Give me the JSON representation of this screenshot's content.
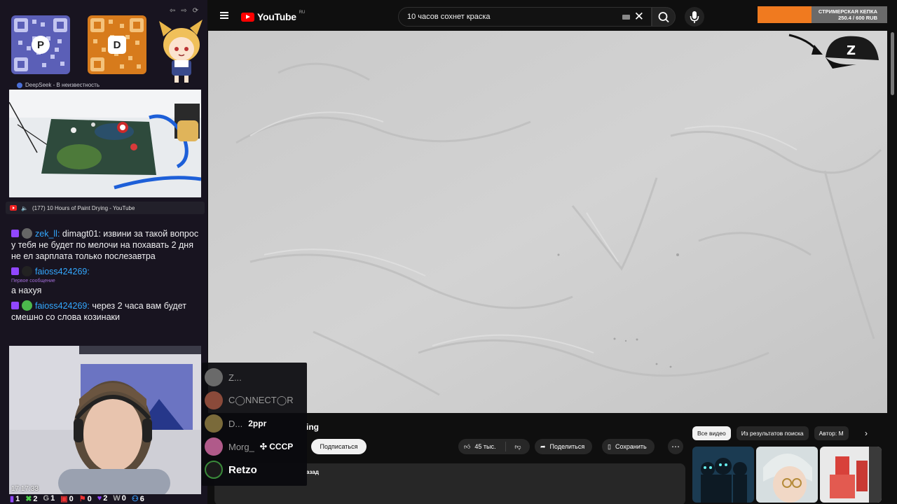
{
  "stream": {
    "deepseek_label": "DeepSeek - В неизвестность",
    "pip_caption": "(177) 10 Hours of Paint Drying - YouTube",
    "clock": "17:17:33",
    "stats": [
      {
        "icon": "user-icon",
        "value": "1"
      },
      {
        "icon": "sword-icon",
        "value": "2"
      },
      {
        "icon": "g-icon",
        "value": "1"
      },
      {
        "icon": "camera-icon",
        "value": "0"
      },
      {
        "icon": "flag-icon",
        "value": "0"
      },
      {
        "icon": "heart-icon",
        "value": "2"
      },
      {
        "icon": "w-icon",
        "value": "0"
      },
      {
        "icon": "people-icon",
        "value": "6"
      }
    ]
  },
  "chat": [
    {
      "name": "zek_ll:",
      "text": "dimagt01: извини за такой вопрос у тебя не будет по мелочи на похавать 2 дня не ел зарплата только послезавтра",
      "first": ""
    },
    {
      "name": "faioss424269:",
      "text": "а нахуя",
      "first": "Первое сообщение"
    },
    {
      "name": "faioss424269:",
      "text": "через 2 часа вам будет смешно со слова козинаки",
      "first": ""
    }
  ],
  "viewers": [
    {
      "name": "Z...",
      "tag": "",
      "bright": false
    },
    {
      "name": "C◯NNECT◯R",
      "tag": "",
      "bright": false
    },
    {
      "name": "D...",
      "tag": "2ppr",
      "bright": false
    },
    {
      "name": "Morg_",
      "tag": "✣ СССР",
      "bright": false
    },
    {
      "name": "Retzo",
      "tag": "",
      "bright": true
    }
  ],
  "donation": {
    "title": "СТРИМЕРСКАЯ КЕПКА",
    "amount": "250.4 / 600 RUB",
    "progress": 0.417
  },
  "youtube": {
    "logo_text": "YouTube",
    "region": "RU",
    "search_value": "10 часов сохнет краска",
    "title_fragment": "ing",
    "subscribe": "Подписаться",
    "likes": "45 тыс.",
    "share": "Поделиться",
    "save": "Сохранить",
    "ago_fragment": "азад",
    "chips": [
      "Все видео",
      "Из результатов поиска",
      "Автор: M"
    ]
  },
  "colors": {
    "accent": "#f00",
    "twitch": "#9147ff",
    "link": "#33a8ff",
    "donation": "#f07a1f"
  }
}
